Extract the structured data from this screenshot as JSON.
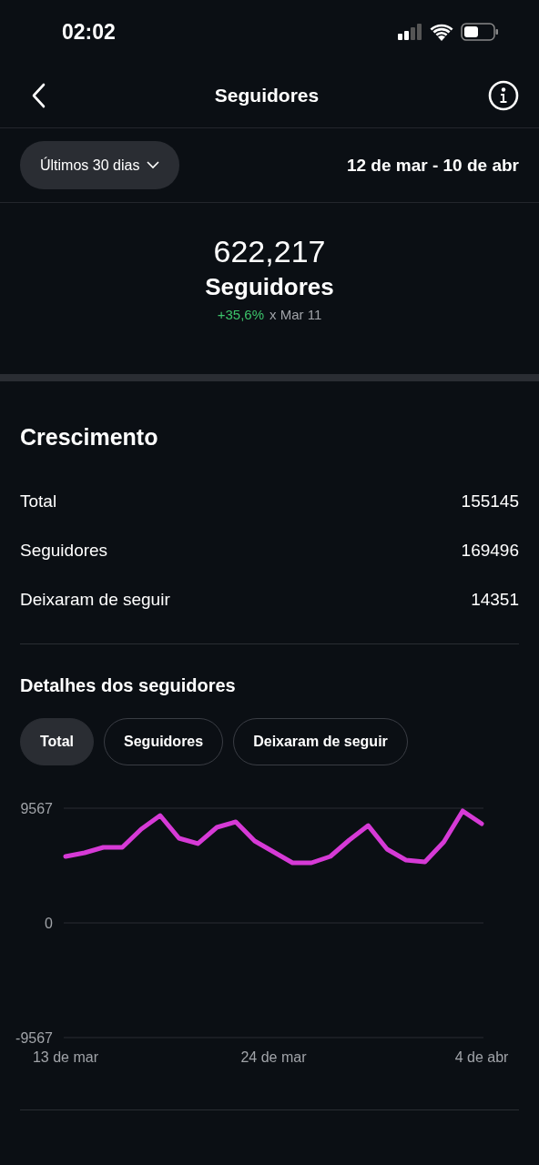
{
  "status_bar": {
    "time": "02:02"
  },
  "header": {
    "title": "Seguidores"
  },
  "filter": {
    "period": "Últimos 30 dias",
    "date_range": "12 de mar - 10 de abr"
  },
  "summary": {
    "value": "622,217",
    "label": "Seguidores",
    "change": "+35,6%",
    "comparison": "x Mar 11"
  },
  "growth": {
    "title": "Crescimento",
    "rows": [
      {
        "label": "Total",
        "value": "155145"
      },
      {
        "label": "Seguidores",
        "value": "169496"
      },
      {
        "label": "Deixaram de seguir",
        "value": "14351"
      }
    ]
  },
  "details": {
    "title": "Detalhes dos seguidores",
    "chips": [
      {
        "label": "Total",
        "selected": true
      },
      {
        "label": "Seguidores",
        "selected": false
      },
      {
        "label": "Deixaram de seguir",
        "selected": false
      }
    ],
    "chart_data": {
      "type": "line",
      "categories": [
        "13 de mar",
        null,
        null,
        null,
        null,
        null,
        null,
        null,
        null,
        null,
        null,
        "24 de mar",
        null,
        null,
        null,
        null,
        null,
        null,
        null,
        null,
        null,
        null,
        "4 de abr"
      ],
      "series": [
        {
          "color": "#d63ad6",
          "values": [
            5540,
            5850,
            6300,
            6300,
            7820,
            8960,
            7060,
            6610,
            7970,
            8430,
            6830,
            5920,
            5010,
            5010,
            5540,
            6910,
            8120,
            6150,
            5240,
            5090,
            6760,
            9340,
            8280
          ]
        }
      ],
      "ylim": [
        -9567,
        9567
      ],
      "yticks": [
        -9567,
        0,
        9567
      ]
    }
  }
}
